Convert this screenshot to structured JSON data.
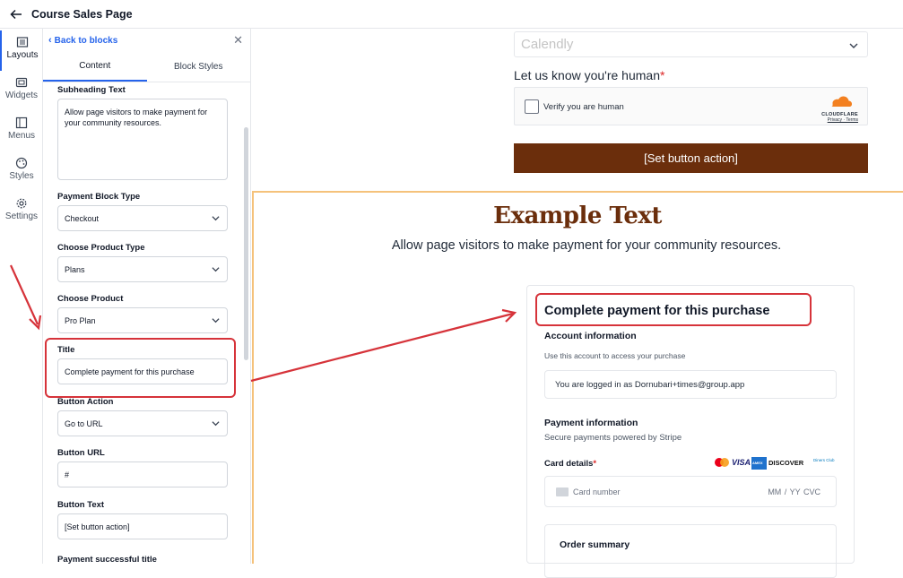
{
  "header": {
    "title": "Course Sales Page"
  },
  "rail": {
    "items": [
      {
        "label": "Layouts",
        "icon": "layouts-icon"
      },
      {
        "label": "Widgets",
        "icon": "widgets-icon"
      },
      {
        "label": "Menus",
        "icon": "menus-icon"
      },
      {
        "label": "Styles",
        "icon": "palette-icon"
      },
      {
        "label": "Settings",
        "icon": "gear-icon"
      }
    ]
  },
  "panel": {
    "back_label": "Back to blocks",
    "tabs": [
      "Content",
      "Block Styles"
    ],
    "fields": {
      "subheading_label": "Subheading Text",
      "subheading_value": "Allow page visitors to make payment for your community resources.",
      "payment_block_type_label": "Payment Block Type",
      "payment_block_type_value": "Checkout",
      "product_type_label": "Choose Product Type",
      "product_type_value": "Plans",
      "product_label": "Choose Product",
      "product_value": "Pro Plan",
      "title_label": "Title",
      "title_value": "Complete payment for this purchase",
      "button_action_label": "Button Action",
      "button_action_value": "Go to URL",
      "button_url_label": "Button URL",
      "button_url_value": "#",
      "button_text_label": "Button Text",
      "button_text_value": "[Set button action]",
      "success_title_label": "Payment successful title"
    }
  },
  "canvas": {
    "calendly_placeholder": "Calendly",
    "human_label": "Let us know you're human",
    "human_required": "*",
    "captcha_text": "Verify you are human",
    "captcha_brand": "CLOUDFLARE",
    "captcha_links": "Privacy · Terms",
    "set_button": "[Set button action]",
    "section_title": "Example Text",
    "section_subtitle": "Allow page visitors to make payment for your community resources.",
    "checkout": {
      "title": "Complete payment for this purchase",
      "account_heading": "Account information",
      "account_hint": "Use this account to access your purchase",
      "account_value": "You are logged in as Dornubari+times@group.app",
      "payment_heading": "Payment information",
      "payment_hint": "Secure payments powered by Stripe",
      "card_label": "Card details",
      "card_required": "*",
      "card_placeholder": "Card number",
      "card_expiry": "MM / YY  CVC",
      "order_summary": "Order summary",
      "brands": [
        "VISA",
        "AMEX",
        "DISCOVER",
        "Diners Club"
      ]
    }
  },
  "colors": {
    "accent": "#2563eb",
    "brand_brown": "#6b2e0c",
    "annotation_red": "#d6333a",
    "section_border": "#f5c27b"
  }
}
